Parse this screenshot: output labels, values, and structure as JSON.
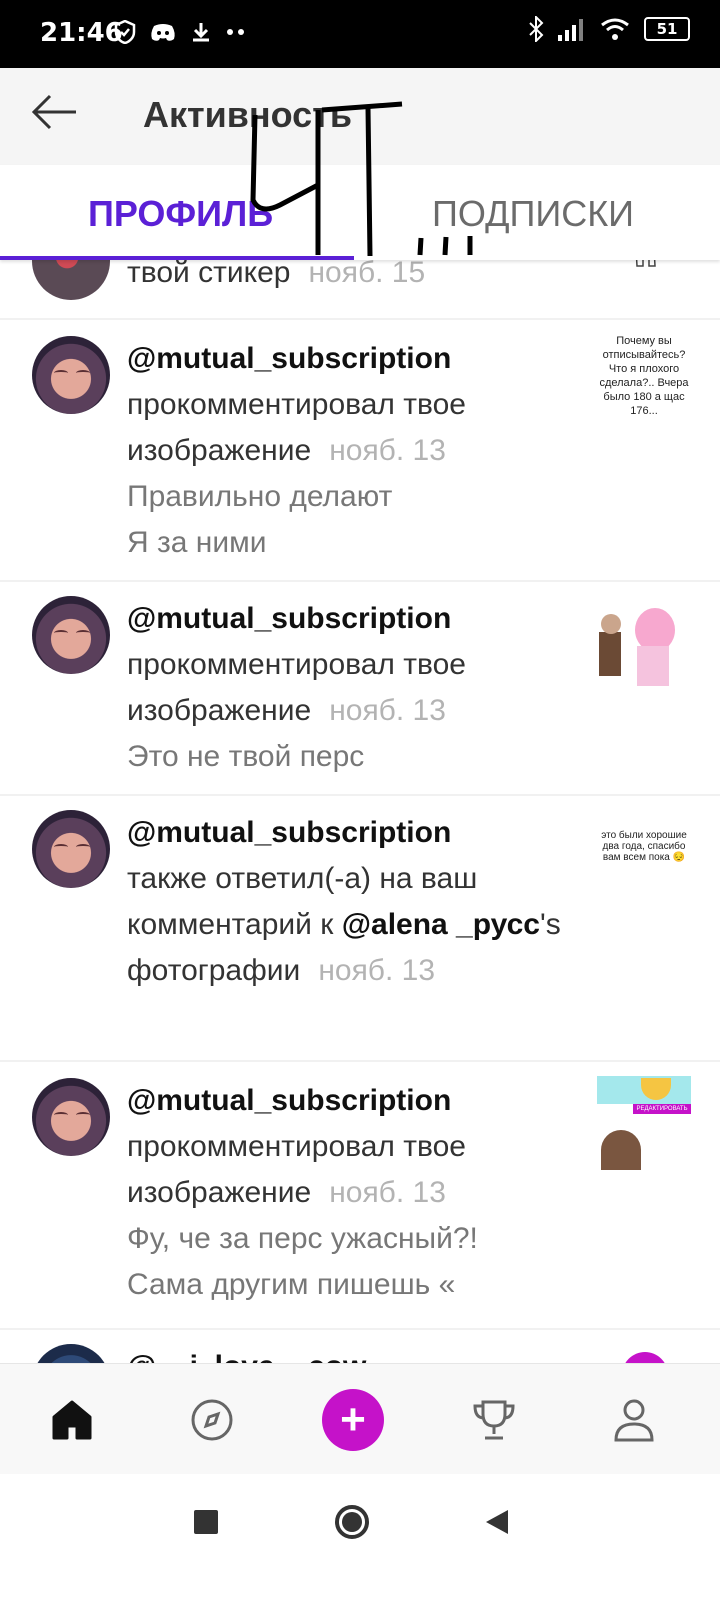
{
  "status_bar": {
    "time": "21:46",
    "battery": "51",
    "left_icons": [
      "shield-icon",
      "discord-icon",
      "download-icon",
      "more-dots-icon"
    ],
    "right_icons": [
      "bluetooth-icon",
      "signal-icon",
      "wifi-icon",
      "battery-icon"
    ]
  },
  "header": {
    "title": "Активность",
    "back_icon": "arrow-left-icon"
  },
  "tabs": [
    {
      "label": "ПРОФИЛЬ",
      "active": true
    },
    {
      "label": "ПОДПИСКИ",
      "active": false
    }
  ],
  "colors": {
    "accent": "#5b20d6",
    "add_button": "#c512c9"
  },
  "feed": {
    "partial_top": {
      "action": "твой стикер",
      "date": "нояб. 15"
    },
    "items": [
      {
        "user": "@mutual_subscription",
        "action": "прокомментировал твое изображение",
        "date": "нояб. 13",
        "comment_lines": [
          "Правильно делают",
          "Я за ними"
        ],
        "thumb_text": "Почему вы отписывайтесь? Что я плохого сделала?.. Вчера было 180 а щас 176..."
      },
      {
        "user": "@mutual_subscription",
        "action": "прокомментировал твое изображение",
        "date": "нояб. 13",
        "comment_lines": [
          "Это не твой перс"
        ],
        "thumb_text": ""
      },
      {
        "user": "@mutual_subscription",
        "action_before": "также ответил(-а) на ваш комментарий к",
        "mention": "@alena _русс",
        "action_after": "'s фотографии",
        "date": "нояб. 13",
        "comment_lines": [],
        "thumb_text": "это были хорошие два года, спасибо вам всем пока 😔"
      },
      {
        "user": "@mutual_subscription",
        "action": "прокомментировал твое изображение",
        "date": "нояб. 13",
        "comment_lines": [
          "Фу, че за перс ужасный?!",
          "Сама другим пишешь «"
        ],
        "thumb_text": "РЕДАКТИРОВАТЬ"
      }
    ],
    "partial_bottom_user": "@__i_love__cow"
  },
  "bottom_nav": [
    "home-icon",
    "compass-icon",
    "add-icon",
    "trophy-icon",
    "profile-icon"
  ],
  "system_nav": [
    "recent-apps-icon",
    "home-circle-icon",
    "back-triangle-icon"
  ]
}
